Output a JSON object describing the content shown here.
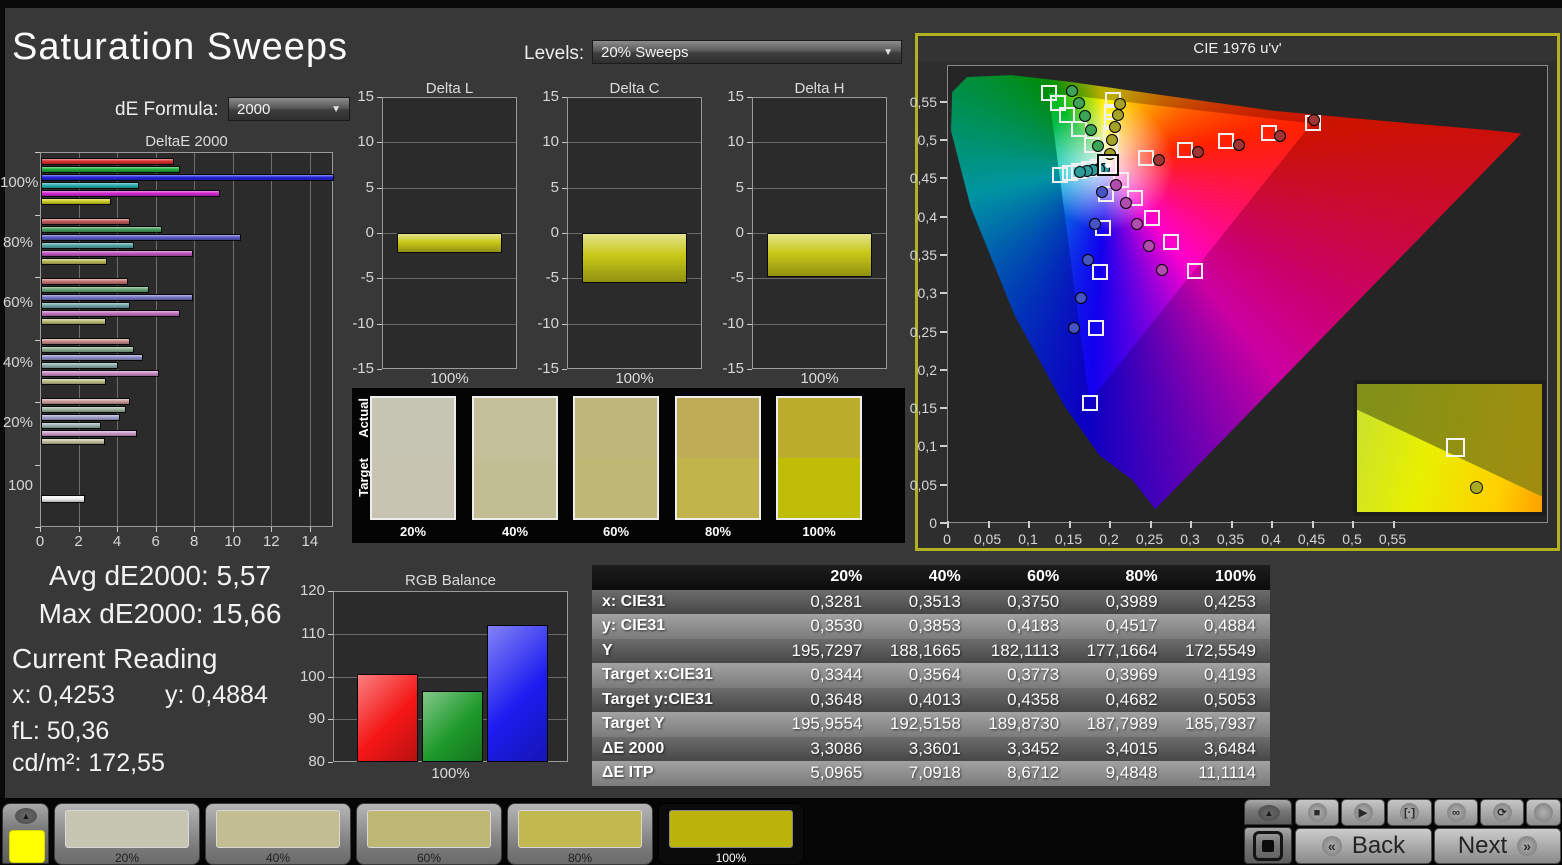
{
  "window": {
    "title": "Saturation Sweeps"
  },
  "controls": {
    "de_formula_label": "dE Formula:",
    "de_formula_value": "2000",
    "levels_label": "Levels:",
    "levels_value": "20% Sweeps"
  },
  "stats": {
    "avg": "Avg dE2000: 5,57",
    "max": "Max dE2000: 15,66",
    "current_reading_label": "Current Reading",
    "x": "x: 0,4253",
    "y": "y: 0,4884",
    "fl": "fL: 50,36",
    "cd": "cd/m²: 172,55"
  },
  "swatch_panel": {
    "row_labels": [
      "Actual",
      "Target"
    ],
    "levels": [
      "20%",
      "40%",
      "60%",
      "80%",
      "100%"
    ],
    "actual_colors": [
      "#c7c6b5",
      "#c3bf98",
      "#bfb77a",
      "#c0ab57",
      "#bcad2c"
    ],
    "target_colors": [
      "#c7c5b1",
      "#c2be94",
      "#bfb774",
      "#c0b44a",
      "#bfbd06"
    ]
  },
  "chart_data": [
    {
      "type": "bar",
      "title": "DeltaE 2000",
      "orientation": "horizontal",
      "categories": [
        "100%",
        "80%",
        "60%",
        "40%",
        "20%",
        "100"
      ],
      "series": [
        {
          "name": "red",
          "values": [
            6.9,
            4.6,
            4.5,
            4.6,
            4.6,
            null
          ]
        },
        {
          "name": "green",
          "values": [
            7.2,
            6.3,
            5.6,
            4.8,
            4.4,
            null
          ]
        },
        {
          "name": "blue",
          "values": [
            15.66,
            10.4,
            7.9,
            5.3,
            4.1,
            null
          ]
        },
        {
          "name": "cyan",
          "values": [
            5.1,
            4.8,
            4.6,
            4.0,
            3.1,
            null
          ]
        },
        {
          "name": "magenta",
          "values": [
            9.3,
            7.9,
            7.2,
            6.1,
            5.0,
            null
          ]
        },
        {
          "name": "yellow",
          "values": [
            3.65,
            3.4,
            3.35,
            3.36,
            3.31,
            null
          ]
        },
        {
          "name": "white",
          "values": [
            null,
            null,
            null,
            null,
            null,
            2.3
          ]
        }
      ],
      "xlim": [
        0,
        15.2
      ],
      "xticks": [
        0,
        2,
        4,
        6,
        8,
        10,
        12,
        14
      ],
      "palette": [
        [
          "#d83030",
          "#1fae3c",
          "#2525dd",
          "#2ab0b0",
          "#d428d4",
          "#cfcf25"
        ],
        [
          "#c25b5b",
          "#47a05c",
          "#5a5ac6",
          "#57a8a8",
          "#c257c0",
          "#bcbc5c"
        ],
        [
          "#c67676",
          "#6aa87a",
          "#7676c6",
          "#74aaaa",
          "#c674c2",
          "#bebe76"
        ],
        [
          "#ca8c8c",
          "#8ab090",
          "#9090ca",
          "#8eb0b0",
          "#ca8ec6",
          "#c0c08e"
        ],
        [
          "#ce9e9e",
          "#9eb6a2",
          "#a2a2ce",
          "#a0b6b6",
          "#ce9eca",
          "#c4c4a0"
        ]
      ],
      "white_color": "#f2f2f2"
    },
    {
      "type": "bar",
      "title": "Delta L",
      "categories": [
        "100%"
      ],
      "values": [
        -2.2
      ],
      "ylim": [
        -15,
        15
      ],
      "yticks": [
        15,
        10,
        5,
        0,
        -5,
        -10,
        -15
      ],
      "bar_color": "#c8c818"
    },
    {
      "type": "bar",
      "title": "Delta C",
      "categories": [
        "100%"
      ],
      "values": [
        -5.5
      ],
      "ylim": [
        -15,
        15
      ],
      "yticks": [
        15,
        10,
        5,
        0,
        -5,
        -10,
        -15
      ],
      "bar_color": "#c8c818"
    },
    {
      "type": "bar",
      "title": "Delta H",
      "categories": [
        "100%"
      ],
      "values": [
        -4.9
      ],
      "ylim": [
        -15,
        15
      ],
      "yticks": [
        15,
        10,
        5,
        0,
        -5,
        -10,
        -15
      ],
      "bar_color": "#c8c818"
    },
    {
      "type": "scatter",
      "title": "CIE 1976 u'v'",
      "xlim": [
        0,
        0.742
      ],
      "ylim": [
        0,
        0.598
      ],
      "xticks": [
        "0",
        "0,05",
        "0,1",
        "0,15",
        "0,2",
        "0,25",
        "0,3",
        "0,35",
        "0,4",
        "0,45",
        "0,5",
        "0,55"
      ],
      "yticks": [
        "0",
        "0,05",
        "0,1",
        "0,15",
        "0,2",
        "0,25",
        "0,3",
        "0,35",
        "0,4",
        "0,45",
        "0,5",
        "0,55"
      ],
      "saturation_labels": [
        "20%",
        "40%",
        "60%",
        "80%",
        "100%"
      ],
      "white_point": {
        "u": 0.1978,
        "v": 0.4683
      },
      "series": [
        {
          "name": "red",
          "color": "#9e3434",
          "targets": [
            [
              0.2442,
              0.4783
            ],
            [
              0.2926,
              0.4888
            ],
            [
              0.343,
              0.4996
            ],
            [
              0.3957,
              0.511
            ],
            [
              0.4507,
              0.5229
            ]
          ],
          "measured": [
            [
              0.26,
              0.475
            ],
            [
              0.309,
              0.485
            ],
            [
              0.359,
              0.495
            ],
            [
              0.41,
              0.506
            ],
            [
              0.452,
              0.528
            ]
          ]
        },
        {
          "name": "green",
          "color": "#3da457",
          "targets": [
            [
              0.1778,
              0.4942
            ],
            [
              0.1612,
              0.5157
            ],
            [
              0.1472,
              0.5338
            ],
            [
              0.1353,
              0.5492
            ],
            [
              0.125,
              0.5625
            ]
          ],
          "measured": [
            [
              0.185,
              0.493
            ],
            [
              0.176,
              0.514
            ],
            [
              0.169,
              0.533
            ],
            [
              0.162,
              0.55
            ],
            [
              0.153,
              0.5655
            ]
          ]
        },
        {
          "name": "blue",
          "color": "#4653c4",
          "targets": [
            [
              0.1952,
              0.4313
            ],
            [
              0.1919,
              0.3861
            ],
            [
              0.1878,
              0.3293
            ],
            [
              0.1825,
              0.256
            ],
            [
              0.1754,
              0.1579
            ]
          ],
          "measured": [
            [
              0.19,
              0.433
            ],
            [
              0.182,
              0.392
            ],
            [
              0.173,
              0.344
            ],
            [
              0.164,
              0.295
            ],
            [
              0.156,
              0.256
            ]
          ]
        },
        {
          "name": "cyan",
          "color": "#2f9c9c",
          "targets": [
            [
              0.1857,
              0.4657
            ],
            [
              0.1736,
              0.4631
            ],
            [
              0.1617,
              0.4605
            ],
            [
              0.15,
              0.458
            ],
            [
              0.1385,
              0.4553
            ]
          ],
          "measured": [
            [
              0.193,
              0.464
            ],
            [
              0.186,
              0.463
            ],
            [
              0.179,
              0.462
            ],
            [
              0.171,
              0.461
            ],
            [
              0.163,
              0.46
            ]
          ]
        },
        {
          "name": "magenta",
          "color": "#b24cae",
          "targets": [
            [
              0.2131,
              0.4486
            ],
            [
              0.2308,
              0.4257
            ],
            [
              0.2514,
              0.3991
            ],
            [
              0.2757,
              0.3676
            ],
            [
              0.305,
              0.3298
            ]
          ],
          "measured": [
            [
              0.208,
              0.443
            ],
            [
              0.22,
              0.419
            ],
            [
              0.233,
              0.392
            ],
            [
              0.248,
              0.363
            ],
            [
              0.264,
              0.331
            ]
          ]
        },
        {
          "name": "yellow",
          "color": "#a6a227",
          "targets": [
            [
              0.1994,
              0.4895
            ],
            [
              0.2007,
              0.5085
            ],
            [
              0.2019,
              0.5247
            ],
            [
              0.2029,
              0.5385
            ],
            [
              0.2039,
              0.5529
            ]
          ],
          "measured": [
            [
              0.1995,
              0.4829
            ],
            [
              0.203,
              0.5011
            ],
            [
              0.2063,
              0.5179
            ],
            [
              0.2093,
              0.5333
            ],
            [
              0.2124,
              0.5487
            ]
          ]
        }
      ]
    },
    {
      "type": "bar",
      "title": "RGB Balance",
      "categories": [
        "Red",
        "Green",
        "Blue"
      ],
      "values": [
        100.7,
        96.5,
        112.1
      ],
      "ylim": [
        80,
        120
      ],
      "yticks": [
        120,
        110,
        100,
        90,
        80
      ],
      "xlabel": "100%",
      "colors": [
        "#f51616",
        "#1d9a2a",
        "#1c1cf0"
      ]
    },
    {
      "type": "table",
      "col_headers": [
        "20%",
        "40%",
        "60%",
        "80%",
        "100%"
      ],
      "rows": [
        {
          "label": "x: CIE31",
          "values": [
            "0,3281",
            "0,3513",
            "0,3750",
            "0,3989",
            "0,4253"
          ]
        },
        {
          "label": "y: CIE31",
          "values": [
            "0,3530",
            "0,3853",
            "0,4183",
            "0,4517",
            "0,4884"
          ]
        },
        {
          "label": "Y",
          "values": [
            "195,7297",
            "188,1665",
            "182,1113",
            "177,1664",
            "172,5549"
          ]
        },
        {
          "label": "Target x:CIE31",
          "values": [
            "0,3344",
            "0,3564",
            "0,3773",
            "0,3969",
            "0,4193"
          ]
        },
        {
          "label": "Target y:CIE31",
          "values": [
            "0,3648",
            "0,4013",
            "0,4358",
            "0,4682",
            "0,5053"
          ]
        },
        {
          "label": "Target Y",
          "values": [
            "195,9554",
            "192,5158",
            "189,8730",
            "187,7989",
            "185,7937"
          ]
        },
        {
          "label": "ΔE 2000",
          "values": [
            "3,3086",
            "3,3601",
            "3,3452",
            "3,4015",
            "3,6484"
          ]
        },
        {
          "label": "ΔE ITP",
          "values": [
            "5,0965",
            "7,0918",
            "8,6712",
            "9,4848",
            "11,1114"
          ]
        }
      ]
    }
  ],
  "bottom_bar": {
    "patch_color": "#ffff00",
    "swatches": [
      {
        "label": "20%",
        "color": "#c7c6b3"
      },
      {
        "label": "40%",
        "color": "#c2be92"
      },
      {
        "label": "60%",
        "color": "#bfb774"
      },
      {
        "label": "80%",
        "color": "#c1b94f"
      },
      {
        "label": "100%",
        "color": "#bcb40d"
      }
    ],
    "selected_index": 4,
    "transport_icons": [
      "stop",
      "play",
      "range",
      "infinity",
      "loop",
      "blank"
    ],
    "nav": {
      "back": "Back",
      "next": "Next",
      "back_arrow": "«",
      "next_arrow": "»"
    }
  }
}
